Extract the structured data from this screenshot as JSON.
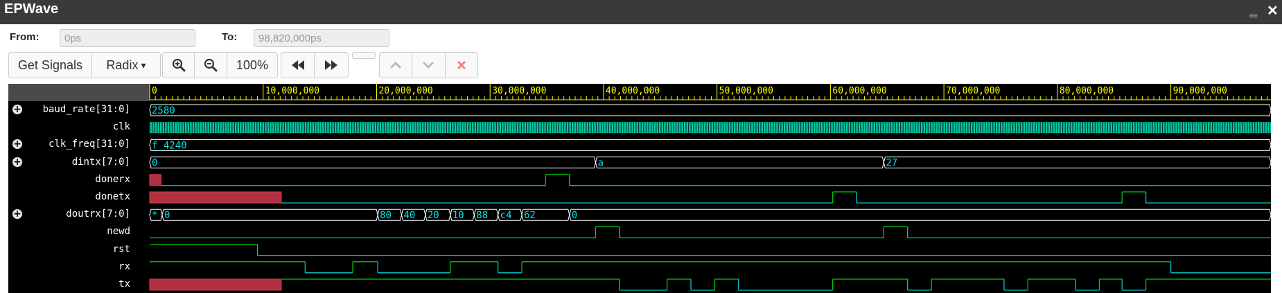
{
  "app": {
    "title": "EPWave",
    "minimize_glyph": "‗",
    "close_glyph": "✕"
  },
  "range": {
    "from_label": "From:",
    "from_value": "0ps",
    "to_label": "To:",
    "to_value": "98,820,000ps"
  },
  "toolbar": {
    "get_signals": "Get Signals",
    "radix": "Radix",
    "radix_caret": "▾",
    "zoom_in_icon": "zoom-in-icon",
    "zoom_out_icon": "zoom-out-icon",
    "zoom_level": "100%",
    "prev_icon": "fast-backward-icon",
    "next_icon": "fast-forward-icon",
    "up_icon": "chevron-up-icon",
    "down_icon": "chevron-down-icon",
    "delete_icon": "close-icon"
  },
  "colors": {
    "ruler_line": "#ffff00",
    "signal_high": "#00cc00",
    "signal_low": "#00c8c8",
    "bus_text": "#00e5e5",
    "bus_line": "#ffffff",
    "unknown_fill": "#b03040",
    "clock": "#00c8a0"
  },
  "ruler": {
    "total": 98820000,
    "major_step": 10000000,
    "minor_per_major": 20,
    "labels": [
      "0",
      "10,000,000",
      "20,000,000",
      "30,000,000",
      "40,000,000",
      "50,000,000",
      "60,000,000",
      "70,000,000",
      "80,000,000",
      "90,000,000"
    ]
  },
  "signals": [
    {
      "name": "baud_rate[31:0]",
      "kind": "bus",
      "expandable": true,
      "segments": [
        {
          "start": 0,
          "end": 98820000,
          "label": "2580"
        }
      ]
    },
    {
      "name": "clk",
      "kind": "clock",
      "expandable": false
    },
    {
      "name": "clk_freq[31:0]",
      "kind": "bus",
      "expandable": true,
      "segments": [
        {
          "start": 0,
          "end": 98820000,
          "label": "f_4240"
        }
      ]
    },
    {
      "name": "dintx[7:0]",
      "kind": "bus",
      "expandable": true,
      "segments": [
        {
          "start": 0,
          "end": 39300000,
          "label": "0"
        },
        {
          "start": 39300000,
          "end": 64700000,
          "label": "a"
        },
        {
          "start": 64700000,
          "end": 98820000,
          "label": "27"
        }
      ]
    },
    {
      "name": "donerx",
      "kind": "bit",
      "expandable": false,
      "unknown": [
        [
          0,
          1000000
        ]
      ],
      "transitions": [
        [
          1000000,
          0
        ],
        [
          34900000,
          1
        ],
        [
          37000000,
          0
        ]
      ]
    },
    {
      "name": "donetx",
      "kind": "bit",
      "expandable": false,
      "unknown": [
        [
          0,
          11600000
        ]
      ],
      "transitions": [
        [
          11600000,
          0
        ],
        [
          60200000,
          1
        ],
        [
          62300000,
          0
        ],
        [
          85700000,
          1
        ],
        [
          87800000,
          0
        ]
      ]
    },
    {
      "name": "doutrx[7:0]",
      "kind": "bus",
      "expandable": true,
      "segments": [
        {
          "start": 0,
          "end": 1100000,
          "label": "*"
        },
        {
          "start": 1100000,
          "end": 20100000,
          "label": "0"
        },
        {
          "start": 20100000,
          "end": 22200000,
          "label": "80"
        },
        {
          "start": 22200000,
          "end": 24300000,
          "label": "40"
        },
        {
          "start": 24300000,
          "end": 26500000,
          "label": "20"
        },
        {
          "start": 26500000,
          "end": 28600000,
          "label": "10"
        },
        {
          "start": 28600000,
          "end": 30700000,
          "label": "88"
        },
        {
          "start": 30700000,
          "end": 32800000,
          "label": "c4"
        },
        {
          "start": 32800000,
          "end": 37000000,
          "label": "62"
        },
        {
          "start": 37000000,
          "end": 98820000,
          "label": "0"
        }
      ]
    },
    {
      "name": "newd",
      "kind": "bit",
      "expandable": false,
      "unknown": [],
      "transitions": [
        [
          0,
          0
        ],
        [
          39300000,
          1
        ],
        [
          41400000,
          0
        ],
        [
          64700000,
          1
        ],
        [
          66800000,
          0
        ]
      ]
    },
    {
      "name": "rst",
      "kind": "bit",
      "expandable": false,
      "unknown": [],
      "transitions": [
        [
          0,
          1
        ],
        [
          9500000,
          0
        ]
      ]
    },
    {
      "name": "rx",
      "kind": "bit",
      "expandable": false,
      "unknown": [],
      "transitions": [
        [
          0,
          1
        ],
        [
          13700000,
          0
        ],
        [
          17900000,
          1
        ],
        [
          20100000,
          0
        ],
        [
          26500000,
          1
        ],
        [
          30700000,
          0
        ],
        [
          32800000,
          1
        ],
        [
          90000000,
          0
        ]
      ]
    },
    {
      "name": "tx",
      "kind": "bit",
      "expandable": false,
      "unknown": [
        [
          0,
          11600000
        ]
      ],
      "transitions": [
        [
          11600000,
          1
        ],
        [
          41400000,
          0
        ],
        [
          45600000,
          1
        ],
        [
          47700000,
          0
        ],
        [
          49800000,
          1
        ],
        [
          51900000,
          0
        ],
        [
          60200000,
          1
        ],
        [
          66800000,
          0
        ],
        [
          68900000,
          1
        ],
        [
          75300000,
          0
        ],
        [
          77400000,
          1
        ],
        [
          81600000,
          0
        ],
        [
          83700000,
          1
        ],
        [
          85700000,
          0
        ],
        [
          87800000,
          1
        ]
      ]
    }
  ]
}
